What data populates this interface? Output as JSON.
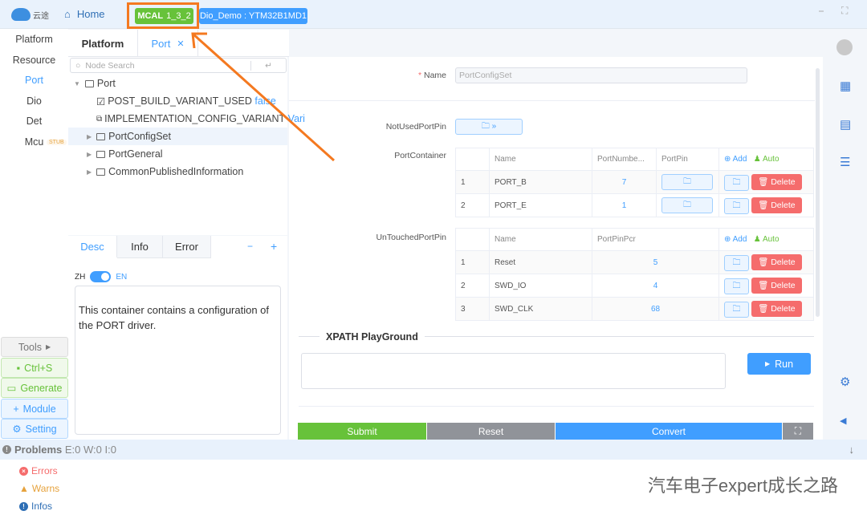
{
  "header": {
    "logo_text": "云途",
    "home": "Home",
    "mcal_label": "MCAL",
    "mcal_version": "1_3_2",
    "project": "Dio_Demo : YTM32B1MD1"
  },
  "sidebar": {
    "items": [
      {
        "label": "Platform"
      },
      {
        "label": "Resource"
      },
      {
        "label": "Port"
      },
      {
        "label": "Dio"
      },
      {
        "label": "Det"
      },
      {
        "label": "Mcu"
      }
    ],
    "stub_badge": "STUB",
    "tools": "Tools",
    "save": "Ctrl+S",
    "generate": "Generate",
    "module": "Module",
    "setting": "Setting"
  },
  "tabs": [
    {
      "label": "Platform"
    },
    {
      "label": "Port"
    }
  ],
  "tree": {
    "search_placeholder": "Node Search",
    "nodes": [
      {
        "label": "Port"
      },
      {
        "label": "POST_BUILD_VARIANT_USED",
        "value": "false"
      },
      {
        "label": "IMPLEMENTATION_CONFIG_VARIANT",
        "value": "Vari"
      },
      {
        "label": "PortConfigSet"
      },
      {
        "label": "PortGeneral"
      },
      {
        "label": "CommonPublishedInformation"
      }
    ]
  },
  "desc": {
    "tabs": [
      "Desc",
      "Info",
      "Error"
    ],
    "lang_zh": "ZH",
    "lang_en": "EN",
    "text": "This container contains a configuration of the PORT driver."
  },
  "form": {
    "name_label": "Name",
    "name_value": "PortConfigSet",
    "not_used_label": "NotUsedPortPin",
    "container_label": "PortContainer",
    "untouched_label": "UnTouchedPortPin",
    "add": "Add",
    "auto": "Auto",
    "delete": "Delete",
    "container_headers": [
      "Name",
      "PortNumbe...",
      "PortPin"
    ],
    "container_rows": [
      {
        "idx": "1",
        "name": "PORT_B",
        "num": "7"
      },
      {
        "idx": "2",
        "name": "PORT_E",
        "num": "1"
      }
    ],
    "untouched_headers": [
      "Name",
      "PortPinPcr"
    ],
    "untouched_rows": [
      {
        "idx": "1",
        "name": "Reset",
        "num": "5"
      },
      {
        "idx": "2",
        "name": "SWD_IO",
        "num": "4"
      },
      {
        "idx": "3",
        "name": "SWD_CLK",
        "num": "68"
      }
    ],
    "xpath_title": "XPATH PlayGround",
    "run": "Run",
    "submit": "Submit",
    "reset": "Reset",
    "convert": "Convert"
  },
  "problems": {
    "title": "Problems",
    "counts": "E:0 W:0 I:0",
    "errors": "Errors",
    "warns": "Warns",
    "infos": "Infos"
  },
  "watermark": "汽车电子expert成长之路",
  "colors": {
    "accent": "#409eff",
    "success": "#67c23a",
    "danger": "#f56c6c",
    "highlight": "#f47920"
  }
}
